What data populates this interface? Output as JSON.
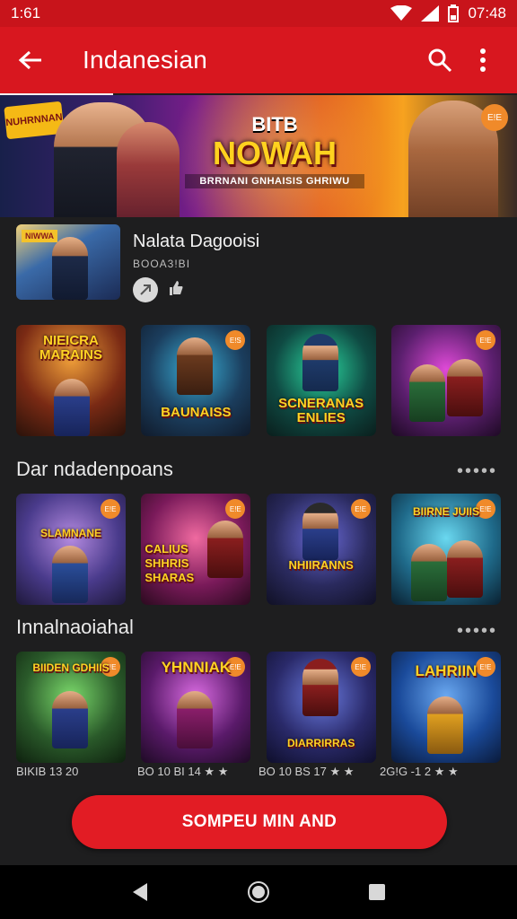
{
  "status_bar": {
    "time": "1:61",
    "right_time": "07:48"
  },
  "app_bar": {
    "title": "Indanesian"
  },
  "hero": {
    "top_text": "BITB",
    "main_text": "NOWAH",
    "sub_text": "BRRNANI GNHAISIS GHRIWU",
    "badge_text": "NUHRNNAN",
    "corner_badge": "E!E"
  },
  "featured": {
    "title": "Nalata Dagooisi",
    "subtitle": "BOOA3!BI",
    "thumb_tag": "NIWWA"
  },
  "row1": [
    {
      "text": "NIEICRA MARAINS",
      "bg": "#3a1e12"
    },
    {
      "text": "BAUNAISS",
      "bg": "#1b3e5e",
      "badge": "E!S"
    },
    {
      "text": "SCNERANAS ENLIES",
      "bg": "#0f4a43"
    },
    {
      "text": "",
      "bg": "#5b1f6e",
      "badge": "E!E"
    }
  ],
  "section2": {
    "title": "Dar ndadenpoans",
    "more": "•••••"
  },
  "row2": [
    {
      "text": "SLAMNANE",
      "bg": "#4a3b8c",
      "badge": "E!E"
    },
    {
      "text": "CALIUS SHHRIS SHARAS",
      "bg": "#7a1a5a",
      "badge": "E!E"
    },
    {
      "text": "NHIIRANNS",
      "bg": "#2a2a5e",
      "badge": "E!E"
    },
    {
      "text": "BIIRNE JUIIS",
      "bg": "#1f6a8a",
      "badge": "E!E"
    }
  ],
  "section3": {
    "title": "Innalnaoiahal",
    "more": "•••••"
  },
  "row3": [
    {
      "text": "BIIDEN GDHIIS",
      "bg": "#2a5a2a",
      "badge": "E!E"
    },
    {
      "text": "YHNNIAK",
      "bg": "#5a1a6a",
      "badge": "E!E"
    },
    {
      "text": "DIARRIRRAS",
      "bg": "#2a2a6a",
      "badge": "E!E"
    },
    {
      "text": "LAHRIIN",
      "bg": "#1a4a9a",
      "badge": "E!E"
    }
  ],
  "meta": [
    "BIKIB 13 20",
    "BO 10 BI 14 ★ ★",
    "BO 10 BS 17 ★ ★",
    "2G!G -1 2 ★ ★"
  ],
  "cta": {
    "label": "SOMPEU MIN AND"
  },
  "colors": {
    "accent": "#e21c24",
    "app_bar": "#d8171f",
    "background": "#1e1e1f"
  }
}
